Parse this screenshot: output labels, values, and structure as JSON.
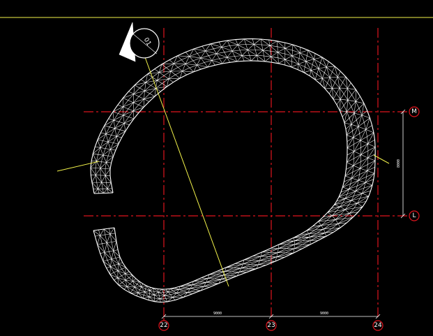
{
  "drawing": {
    "background": "#000000",
    "colors": {
      "axis": "#e0141e",
      "mesh": "#ffffff",
      "annotation": "#f2f24a"
    },
    "grid_axes": {
      "vertical": [
        {
          "label": "22"
        },
        {
          "label": "23"
        },
        {
          "label": "24"
        }
      ],
      "horizontal": [
        {
          "label": "M"
        },
        {
          "label": "L"
        }
      ]
    },
    "dimensions": {
      "bottom": [
        "9000",
        "9000"
      ],
      "right": "8000"
    },
    "north_arrow": {
      "label": "01",
      "icon": "north-arrow-icon"
    }
  }
}
